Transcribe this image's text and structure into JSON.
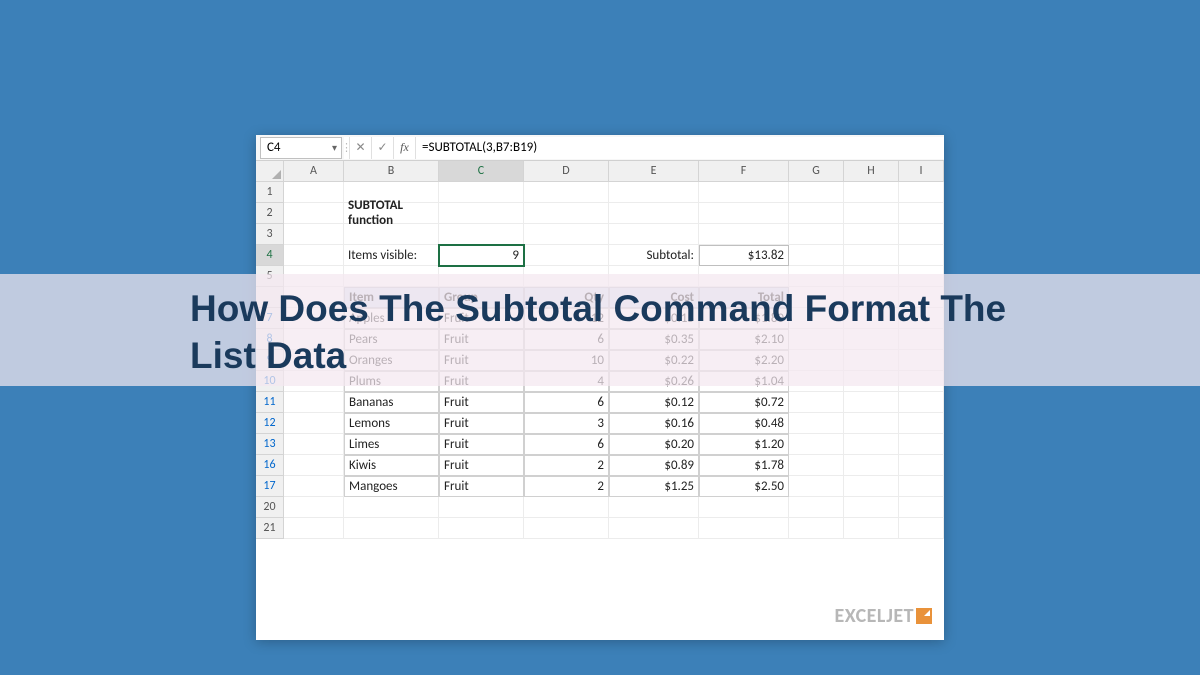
{
  "headline": "How Does The Subtotal Command Format The List Data",
  "watermark": "EXCELJET",
  "formula_bar": {
    "cell_ref": "C4",
    "formula": "=SUBTOTAL(3,B7:B19)"
  },
  "columns": [
    "A",
    "B",
    "C",
    "D",
    "E",
    "F",
    "G",
    "H",
    "I"
  ],
  "row_numbers": [
    "1",
    "2",
    "3",
    "4",
    "5",
    "7",
    "8",
    "9",
    "10",
    "11",
    "12",
    "13",
    "16",
    "17",
    "20",
    "21"
  ],
  "linkish_rows": [
    "7",
    "8",
    "9",
    "10",
    "11",
    "12",
    "13",
    "16",
    "17"
  ],
  "active_row": "4",
  "active_col": "C",
  "labels": {
    "title": "SUBTOTAL function",
    "items_visible": "Items visible:",
    "subtotal": "Subtotal:"
  },
  "values": {
    "items_visible": "9",
    "subtotal": "$13.82"
  },
  "table": {
    "headers": [
      "Item",
      "Group",
      "Qty",
      "Cost",
      "Total"
    ],
    "header_positions": [
      "B",
      "C",
      "D",
      "E",
      "F"
    ],
    "rows": [
      {
        "r": "7",
        "item": "Apples",
        "group": "Fruit",
        "qty": "12",
        "cost": "$0.15",
        "total": "$1.80"
      },
      {
        "r": "8",
        "item": "Pears",
        "group": "Fruit",
        "qty": "6",
        "cost": "$0.35",
        "total": "$2.10"
      },
      {
        "r": "9",
        "item": "Oranges",
        "group": "Fruit",
        "qty": "10",
        "cost": "$0.22",
        "total": "$2.20"
      },
      {
        "r": "10",
        "item": "Plums",
        "group": "Fruit",
        "qty": "4",
        "cost": "$0.26",
        "total": "$1.04"
      },
      {
        "r": "11",
        "item": "Bananas",
        "group": "Fruit",
        "qty": "6",
        "cost": "$0.12",
        "total": "$0.72"
      },
      {
        "r": "12",
        "item": "Lemons",
        "group": "Fruit",
        "qty": "3",
        "cost": "$0.16",
        "total": "$0.48"
      },
      {
        "r": "13",
        "item": "Limes",
        "group": "Fruit",
        "qty": "6",
        "cost": "$0.20",
        "total": "$1.20"
      },
      {
        "r": "16",
        "item": "Kiwis",
        "group": "Fruit",
        "qty": "2",
        "cost": "$0.89",
        "total": "$1.78"
      },
      {
        "r": "17",
        "item": "Mangoes",
        "group": "Fruit",
        "qty": "2",
        "cost": "$1.25",
        "total": "$2.50"
      }
    ]
  }
}
